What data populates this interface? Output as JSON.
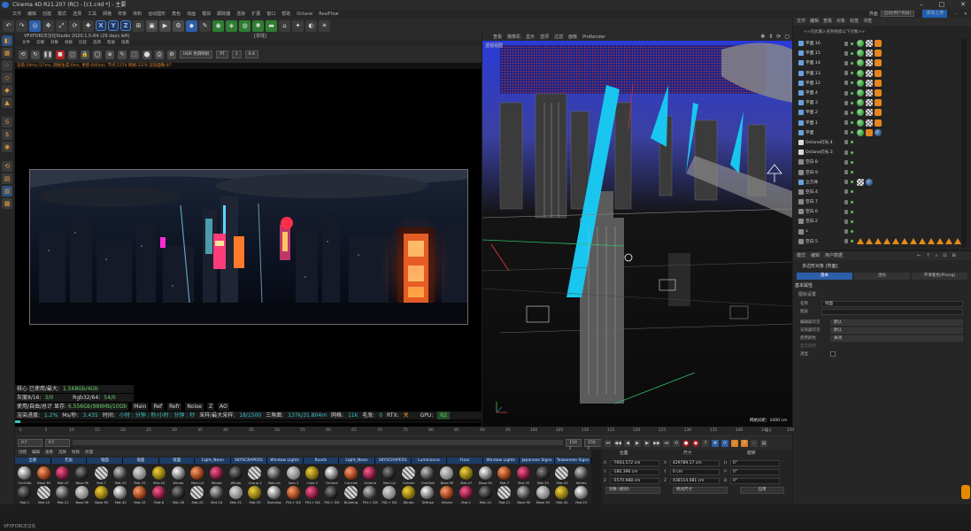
{
  "titlebar": {
    "title": "Cinema 4D R21.207 (RC) - [c1.c4d *] - 主要"
  },
  "menubar": {
    "items": [
      "文件",
      "编辑",
      "创建",
      "模式",
      "选择",
      "工具",
      "网格",
      "样条",
      "体积",
      "运动图形",
      "角色",
      "动画",
      "模拟",
      "跟踪器",
      "渲染",
      "扩展",
      "窗口",
      "帮助",
      "Octane",
      "RealFlow"
    ],
    "layout_label": "界面",
    "layout_value": "启动(用户布局)",
    "upload_label": "添加上传"
  },
  "picture_viewer": {
    "title": "VFXFORCE汉化Studio 2020.1.5-R4 (29 days left)",
    "hash_label": "[非线]",
    "menu": [
      "文件",
      "云端",
      "对象",
      "材质",
      "比较",
      "选项",
      "帮助",
      "指南"
    ],
    "hdr_label": "HDR 色调映射",
    "pt_label": "PT",
    "frame_value": "1",
    "zoom_value": "0.4",
    "status_line": "渲染:29ms./37ms, 网格生成:0ms, 更新:0(0)ms, 节点:2374 网格:2374 渲染面数:87",
    "stats": {
      "vram_label": "核心 已使用/最大:",
      "vram_value": "1.568Gb/4Gb",
      "grey_label": "灰度8/16:",
      "grey_value": "3/0",
      "rgb_label": "Rgb32/64:",
      "rgb_value": "54/0",
      "mem_label": "使用/自由/总计 显存:",
      "mem_value": "6.556Gb/986Mb/10Gb",
      "passes": [
        "Main",
        "Ref",
        "Refr",
        "Noise",
        "Z",
        "AO"
      ],
      "progress_label": "渲染进度:",
      "progress_value": "1.2%",
      "ms_label": "Ms/秒:",
      "ms_value": "3.435",
      "time_label": "时间:",
      "time_value": "小时 : 分钟 : 秒/小时 : 分钟 : 秒",
      "samples_label": "采样/最大采样:",
      "samples_value": "18/1500",
      "tri_label": "三角面:",
      "tri_value": "137k/31.804m",
      "mesh_label": "网格:",
      "mesh_value": "11k",
      "hair_label": "毛发:",
      "hair_value": "0",
      "rtx_label": "RTX:",
      "rtx_value": "关",
      "gpu_label": "GPU:",
      "gpu_value": "62"
    }
  },
  "viewport": {
    "menu": [
      "查看",
      "摄像机",
      "显示",
      "选项",
      "过滤",
      "面板",
      "ProRender"
    ],
    "label": "透视视图",
    "grid_info": "网格间距：1000 cm"
  },
  "object_manager": {
    "menu": [
      "文件",
      "编辑",
      "查看",
      "对象",
      "标签",
      "书签"
    ],
    "search_hint": "<<在此输入名称搜索以下对象>>",
    "rows": [
      {
        "name": "平面.16",
        "type": "plane",
        "tags": [
          "g",
          "ch",
          "or"
        ]
      },
      {
        "name": "平面.15",
        "type": "plane",
        "tags": [
          "g",
          "ch",
          "or"
        ]
      },
      {
        "name": "平面.14",
        "type": "plane",
        "tags": [
          "g",
          "ch",
          "or"
        ]
      },
      {
        "name": "平面.13",
        "type": "plane",
        "tags": [
          "g",
          "ch",
          "or"
        ]
      },
      {
        "name": "平面.12",
        "type": "plane",
        "tags": [
          "g",
          "ch",
          "or"
        ]
      },
      {
        "name": "平面.4",
        "type": "plane",
        "tags": [
          "g",
          "ch",
          "or"
        ]
      },
      {
        "name": "平面.3",
        "type": "plane",
        "tags": [
          "g",
          "ch",
          "or"
        ]
      },
      {
        "name": "平面.2",
        "type": "plane",
        "tags": [
          "g",
          "ch",
          "or"
        ]
      },
      {
        "name": "平面.1",
        "type": "plane",
        "tags": [
          "g",
          "ch",
          "or"
        ]
      },
      {
        "name": "平面",
        "type": "plane",
        "tags": [
          "g",
          "or",
          "sp"
        ]
      },
      {
        "name": "Octane灯光.4",
        "type": "light",
        "tags": []
      },
      {
        "name": "Octane灯光.3",
        "type": "light",
        "tags": []
      },
      {
        "name": "空白.8",
        "type": "null",
        "tags": []
      },
      {
        "name": "空白.9",
        "type": "null",
        "tags": []
      },
      {
        "name": "立方体",
        "type": "cube",
        "tags": [
          "ch",
          "sp"
        ]
      },
      {
        "name": "空白.4",
        "type": "null",
        "tags": []
      },
      {
        "name": "空白.7",
        "type": "null",
        "tags": []
      },
      {
        "name": "空白.6",
        "type": "null",
        "tags": []
      },
      {
        "name": "空白.2",
        "type": "null",
        "tags": []
      },
      {
        "name": "1",
        "type": "null",
        "tags": []
      },
      {
        "name": "空白.5",
        "type": "null",
        "tags": [
          "warn",
          "warn",
          "warn",
          "warn",
          "warn",
          "warn",
          "warn",
          "warn",
          "warn",
          "warn",
          "warn",
          "warn"
        ]
      }
    ]
  },
  "attribute_manager": {
    "menu": [
      "模式",
      "编辑",
      "用户数据"
    ],
    "title": "多边形对象 [地面]",
    "tabs": [
      "基本",
      "坐标",
      "平滑着色(Phong)"
    ],
    "section": "基本属性",
    "subsection": "图标设置",
    "fields": [
      {
        "label": "名称",
        "value": "地面"
      },
      {
        "label": "图层",
        "value": ""
      },
      {
        "label": "编辑器可见",
        "value": "默认"
      },
      {
        "label": "渲染器可见",
        "value": "默认"
      },
      {
        "label": "使用颜色",
        "value": "关闭"
      },
      {
        "label": "显示颜色",
        "value": ""
      },
      {
        "label": "透显",
        "value": ""
      }
    ]
  },
  "timeline": {
    "ticks": [
      "0",
      "5",
      "10",
      "15",
      "20",
      "25",
      "30",
      "35",
      "40",
      "45",
      "50",
      "55",
      "60",
      "65",
      "70",
      "75",
      "80",
      "85",
      "90",
      "95",
      "100",
      "105",
      "110",
      "115",
      "120",
      "125",
      "130",
      "135",
      "140",
      "145",
      "150"
    ],
    "start": "0 F",
    "current": "0 F",
    "end": "150 F",
    "end2": "150 F",
    "frame_readout": "0 F"
  },
  "material_manager": {
    "menu": [
      "创建",
      "编辑",
      "查看",
      "选择",
      "材质",
      "纹理"
    ],
    "categories": [
      "全部",
      "无层",
      "墙面",
      "墙面",
      "墙面",
      "Light_Neon",
      "SKYSCRAPERS",
      "Window Lights",
      "Roads",
      "Light_Neon",
      "SKYSCRAPERS",
      "Luminance",
      "Floor",
      "Window Lights",
      "Japanese Signs",
      "Taiwanese Signs"
    ],
    "row1": [
      "OctGlob",
      "Base Mi",
      "Mat.47",
      "Base Mi",
      "Mat.7",
      "Mat.32",
      "Mat.33",
      "Mat.43",
      "Windo",
      "Mat.cyt",
      "Windo",
      "Windo",
      "Group.1",
      "Mat.cyt",
      "holo 2",
      "holo 2",
      "Octane",
      "Concret",
      "Octane",
      "Mat.cyt",
      "Octane",
      "OctGlob",
      "Base Mi",
      "Mat.47",
      "Base Mi",
      "Mat.7",
      "Mat.32",
      "Mat.33",
      "Mat.43",
      "Windo"
    ],
    "row2": [
      "Mat.1",
      "Mat.10",
      "Mat.21",
      "Base Mi",
      "Base Mi",
      "Mat.42",
      "Mat.15",
      "Mat.6",
      "Mat.18",
      "Mat.20",
      "Mat.24",
      "Mat.31",
      "Mat.35",
      "Building",
      "PXL+ DX",
      "PXL+ DX",
      "PXL+ DX",
      "Building",
      "PXL+ DX",
      "PXL+ DX",
      "Windo",
      "Diffuse",
      "Windo",
      "Mat.1",
      "Mat.10",
      "Mat.21",
      "Base Mi",
      "Base Mi",
      "Mat.42",
      "Mat.15"
    ]
  },
  "coord_manager": {
    "headers": [
      "位置",
      "尺寸",
      "旋转"
    ],
    "rows": [
      {
        "axis": "X",
        "pos": "-7693.572 cm",
        "size": "429789.17 cm",
        "rot_axis": "H",
        "rot": "0°"
      },
      {
        "axis": "Y",
        "pos": "-180.396 cm",
        "size": "0 cm",
        "rot_axis": "P",
        "rot": "0°"
      },
      {
        "axis": "Z",
        "pos": "-5570.988 cm",
        "size": "438114.081 cm",
        "rot_axis": "B",
        "rot": "0°"
      }
    ],
    "mode1": "对象 (相对)",
    "mode2": "绝对尺寸",
    "apply": "应用"
  },
  "statusbar": {
    "text": "VFXFORCE汉化"
  }
}
